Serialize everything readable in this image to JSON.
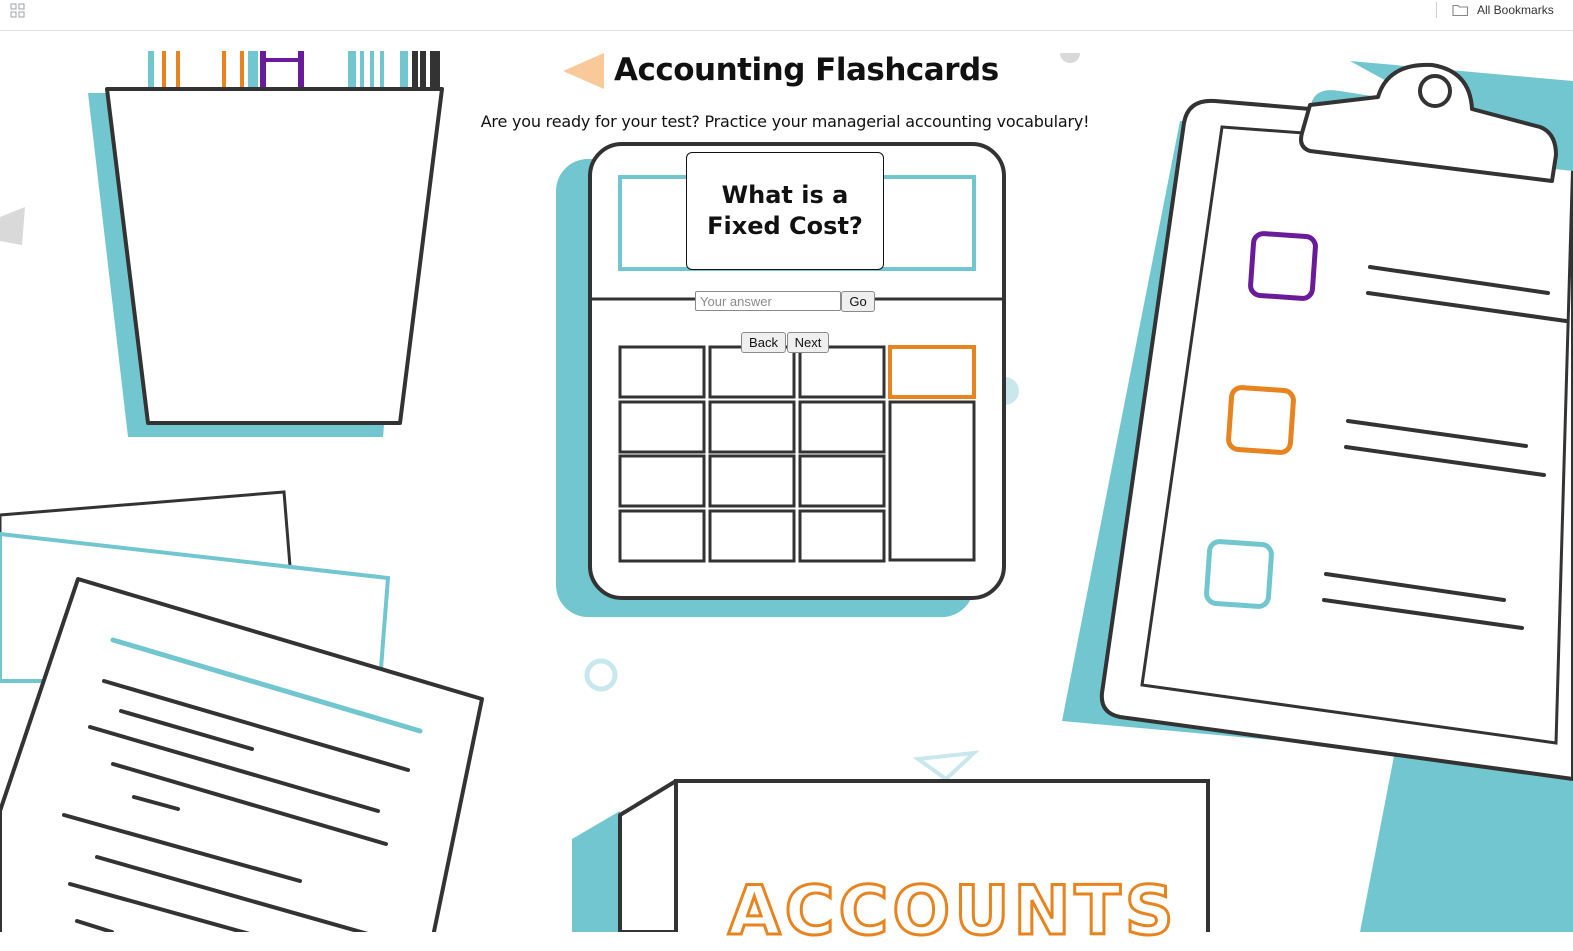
{
  "bookmarks_bar": {
    "apps_icon": "apps-grid-icon",
    "folder_icon": "folder-icon",
    "all_bookmarks_label": "All Bookmarks"
  },
  "page": {
    "title": "Accounting Flashcards",
    "subtitle": "Are you ready for your test? Practice your managerial accounting vocabulary!",
    "flashcard_question": "What is a Fixed Cost?",
    "answer_placeholder": "Your answer",
    "answer_value": "",
    "go_label": "Go",
    "back_label": "Back",
    "next_label": "Next"
  },
  "illustration": {
    "box_label": "ACCOUNTS"
  },
  "colors": {
    "teal": "#72c6d0",
    "orange": "#e8841f",
    "purple": "#6a1b9a",
    "peach": "#f9c99a",
    "outline": "#333333"
  }
}
